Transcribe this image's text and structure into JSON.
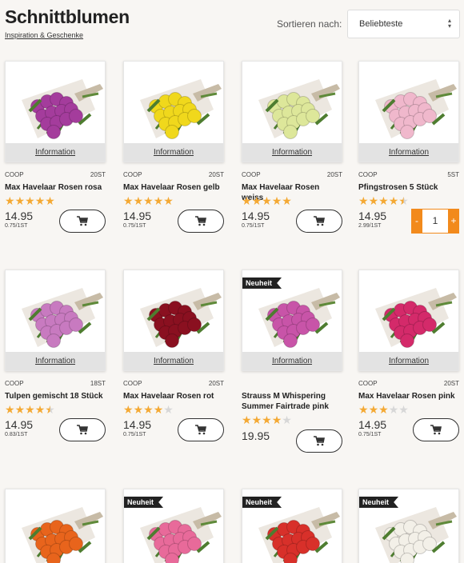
{
  "header": {
    "title": "Schnittblumen",
    "subtitle": "Inspiration & Geschenke",
    "sort_label": "Sortieren nach:",
    "sort_value": "Beliebteste"
  },
  "info_label": "Information",
  "badge_label": "Neuheit",
  "colors": {
    "accent": "#f28a1c",
    "star": "#f4a934"
  },
  "products": [
    {
      "brand": "COOP",
      "qty": "20ST",
      "name": "Max Havelaar Rosen rosa",
      "rating": 5,
      "price": "14.95",
      "unit": "0.75/1ST",
      "cart": "button",
      "flower": "#a43c9c",
      "badge": false
    },
    {
      "brand": "COOP",
      "qty": "20ST",
      "name": "Max Havelaar Rosen gelb",
      "rating": 5,
      "price": "14.95",
      "unit": "0.75/1ST",
      "cart": "button",
      "flower": "#f0d81c",
      "badge": false
    },
    {
      "brand": "COOP",
      "qty": "20ST",
      "name": "Max Havelaar Rosen weiss",
      "rating": 5,
      "price": "14.95",
      "unit": "0.75/1ST",
      "cart": "button",
      "flower": "#dde79a",
      "badge": false
    },
    {
      "brand": "COOP",
      "qty": "5ST",
      "name": "Pfingstrosen 5 Stück",
      "rating": 4.5,
      "price": "14.95",
      "unit": "2.99/1ST",
      "cart": "stepper",
      "stepper_value": "1",
      "flower": "#f0b8cc",
      "badge": false
    },
    {
      "brand": "COOP",
      "qty": "18ST",
      "name": "Tulpen gemischt 18 Stück",
      "rating": 4.5,
      "price": "14.95",
      "unit": "0.83/1ST",
      "cart": "button",
      "flower": "#c87ac0",
      "badge": false
    },
    {
      "brand": "COOP",
      "qty": "20ST",
      "name": "Max Havelaar Rosen rot",
      "rating": 4,
      "price": "14.95",
      "unit": "0.75/1ST",
      "cart": "button",
      "flower": "#8a1020",
      "badge": false
    },
    {
      "brand": "",
      "qty": "",
      "name": "Strauss M Whispering Summer Fairtrade pink",
      "rating": 4,
      "price": "19.95",
      "unit": "",
      "cart": "button",
      "flower": "#c854a8",
      "badge": true
    },
    {
      "brand": "COOP",
      "qty": "20ST",
      "name": "Max Havelaar Rosen pink",
      "rating": 3,
      "price": "14.95",
      "unit": "0.75/1ST",
      "cart": "button",
      "flower": "#d42a6a",
      "badge": false
    },
    {
      "flower": "#e8641c",
      "badge": false
    },
    {
      "flower": "#e86a9a",
      "badge": true
    },
    {
      "flower": "#d8302a",
      "badge": true
    },
    {
      "flower": "#f3f0e8",
      "badge": true
    }
  ]
}
